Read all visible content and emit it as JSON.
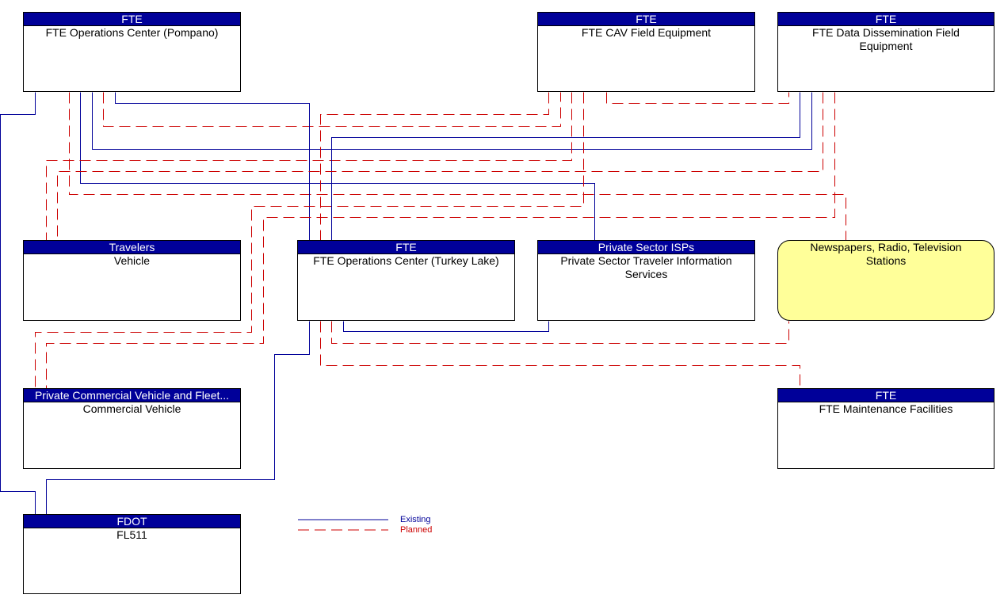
{
  "diagram": {
    "nodes": [
      {
        "id": "pompano",
        "group": "FTE",
        "name": "FTE Operations Center (Pompano)",
        "kind": "center"
      },
      {
        "id": "cav",
        "group": "FTE",
        "name": "FTE CAV Field Equipment",
        "kind": "field"
      },
      {
        "id": "dissem",
        "group": "FTE",
        "name": "FTE Data Dissemination Field Equipment",
        "kind": "field"
      },
      {
        "id": "vehicle",
        "group": "Travelers",
        "name": "Vehicle",
        "kind": "vehicle"
      },
      {
        "id": "turkey",
        "group": "FTE",
        "name": "FTE Operations Center (Turkey Lake)",
        "kind": "center"
      },
      {
        "id": "isp",
        "group": "Private Sector ISPs",
        "name": "Private Sector Traveler Information Services",
        "kind": "center"
      },
      {
        "id": "media",
        "group": "",
        "name": "Newspapers, Radio, Television Stations",
        "kind": "terminator"
      },
      {
        "id": "cvo",
        "group": "Private Commercial Vehicle and Fleet...",
        "name": "Commercial Vehicle",
        "kind": "vehicle"
      },
      {
        "id": "maint",
        "group": "FTE",
        "name": "FTE Maintenance Facilities",
        "kind": "center"
      },
      {
        "id": "fl511",
        "group": "FDOT",
        "name": "FL511",
        "kind": "center"
      }
    ],
    "connections": [
      {
        "from": "pompano",
        "to": "fl511",
        "status": "existing"
      },
      {
        "from": "pompano",
        "to": "media",
        "status": "planned"
      },
      {
        "from": "pompano",
        "to": "isp",
        "status": "existing"
      },
      {
        "from": "pompano",
        "to": "dissem",
        "status": "existing"
      },
      {
        "from": "pompano",
        "to": "cav",
        "status": "planned"
      },
      {
        "from": "pompano",
        "to": "turkey",
        "status": "existing"
      },
      {
        "from": "cav",
        "to": "turkey",
        "status": "planned"
      },
      {
        "from": "cav",
        "to": "vehicle",
        "status": "planned"
      },
      {
        "from": "cav",
        "to": "cvo",
        "status": "planned"
      },
      {
        "from": "cav",
        "to": "dissem",
        "status": "planned"
      },
      {
        "from": "dissem",
        "to": "turkey",
        "status": "existing"
      },
      {
        "from": "dissem",
        "to": "vehicle",
        "status": "planned"
      },
      {
        "from": "dissem",
        "to": "cvo",
        "status": "planned"
      },
      {
        "from": "turkey",
        "to": "fl511",
        "status": "existing"
      },
      {
        "from": "turkey",
        "to": "isp",
        "status": "existing"
      },
      {
        "from": "turkey",
        "to": "media",
        "status": "planned"
      },
      {
        "from": "turkey",
        "to": "maint",
        "status": "planned"
      }
    ]
  },
  "legend": {
    "existing": {
      "label": "Existing",
      "color": "#000099"
    },
    "planned": {
      "label": "Planned",
      "color": "#cc0000"
    }
  },
  "colors": {
    "header_bg": "#000099",
    "terminator_bg": "#ffff99"
  }
}
